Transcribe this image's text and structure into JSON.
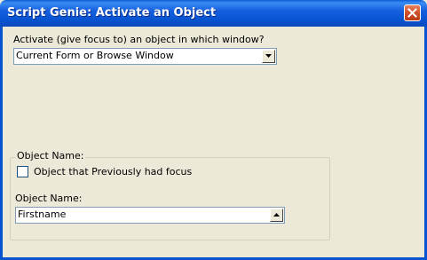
{
  "window": {
    "title": "Script Genie:  Activate an Object",
    "close_icon": "close-icon"
  },
  "activate": {
    "prompt_label": "Activate (give focus to) an object in which window?",
    "window_select_value": "Current Form or Browse Window",
    "dropdown_icon": "chevron-down-icon"
  },
  "object_group": {
    "legend": "Object Name:",
    "checkbox_label": "Object that Previously had focus",
    "checkbox_checked": false,
    "name_label": "Object Name:",
    "name_value": "Firstname",
    "spinner_icon": "chevron-up-icon"
  }
}
